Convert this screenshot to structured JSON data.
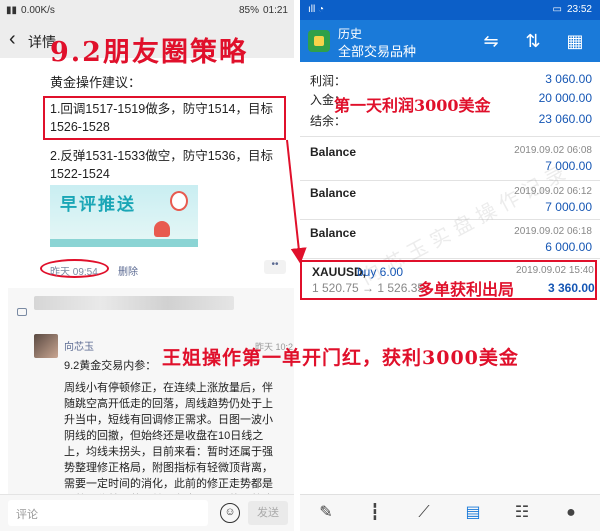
{
  "left": {
    "status": {
      "signal": "▮▮",
      "speed": "0.00K/s",
      "battery": "85%",
      "time": "01:21"
    },
    "header": {
      "back_icon": "chevron-left-icon",
      "title": "详情"
    },
    "overlay_title": "9.2朋友圈策略",
    "post": {
      "heading": "黄金操作建议：",
      "advice1": "1.回调1517-1519做多，防守1514，目标1526-1528",
      "advice2": "2.反弹1531-1533做空，防守1536，目标1522-1524",
      "banner_text": "早评推送",
      "time": "昨天 09:54",
      "delete_label": "删除",
      "more_label": "••"
    },
    "comment": {
      "name": "向芯玉",
      "time": "昨天 10:2",
      "quote_title": "9.2黄金交易内参：",
      "body": "周线小有停顿修正，在连续上涨放量后，伴随跳空高开低走的回落，周线趋势仍处于上升当中，短线有回调修正需求。日图一波小阴线的回撤，但始终还是收盘在10日线之上，均线未拐头，目前来看：暂时还属于强势整理修正格局，附图指标有轻微顶背离，需要一定时间的消化，此前的修正走势都是以整理代替回落。并没有出现明显的调整浪"
    },
    "bottom": {
      "comment_placeholder": "评论",
      "emoji_icon": "☺",
      "send_label": "发送"
    }
  },
  "right": {
    "status": {
      "left": "ıll ◔",
      "time": "23:52"
    },
    "header": {
      "title": "历史",
      "subtitle": "全部交易品种",
      "icons": [
        "sort-icon",
        "arrows-updown-icon",
        "calendar-icon"
      ]
    },
    "summary": [
      {
        "label": "利润：",
        "value": "3 060.00"
      },
      {
        "label": "入金：",
        "value": "20 000.00"
      },
      {
        "label": "结余：",
        "value": "23 060.00"
      }
    ],
    "profit_overlay": "第一天利润3000美金",
    "balances": [
      {
        "label": "Balance",
        "time": "2019.09.02 06:08",
        "value": "7 000.00"
      },
      {
        "label": "Balance",
        "time": "2019.09.02 06:12",
        "value": "7 000.00"
      },
      {
        "label": "Balance",
        "time": "2019.09.02 06:18",
        "value": "6 000.00"
      }
    ],
    "trade": {
      "symbol": "XAUUSD,",
      "direction": "buy 6.00",
      "price": "1 520.75 → 1 526.35",
      "time": "2019.09.02 15:40",
      "profit": "3 360.00",
      "overlay": "多单获利出局"
    },
    "watermark": "向芯玉实盘操作记录",
    "nav_icons": [
      "trade-icon",
      "candles-icon",
      "chart-icon",
      "inbox-icon",
      "news-icon",
      "chat-icon"
    ]
  },
  "caption": "王姐操作第一单开门红，获利3000美金",
  "colors": {
    "accent_red": "#e0102b",
    "mt4_blue": "#1a7ad9",
    "value_blue": "#1556b4"
  }
}
